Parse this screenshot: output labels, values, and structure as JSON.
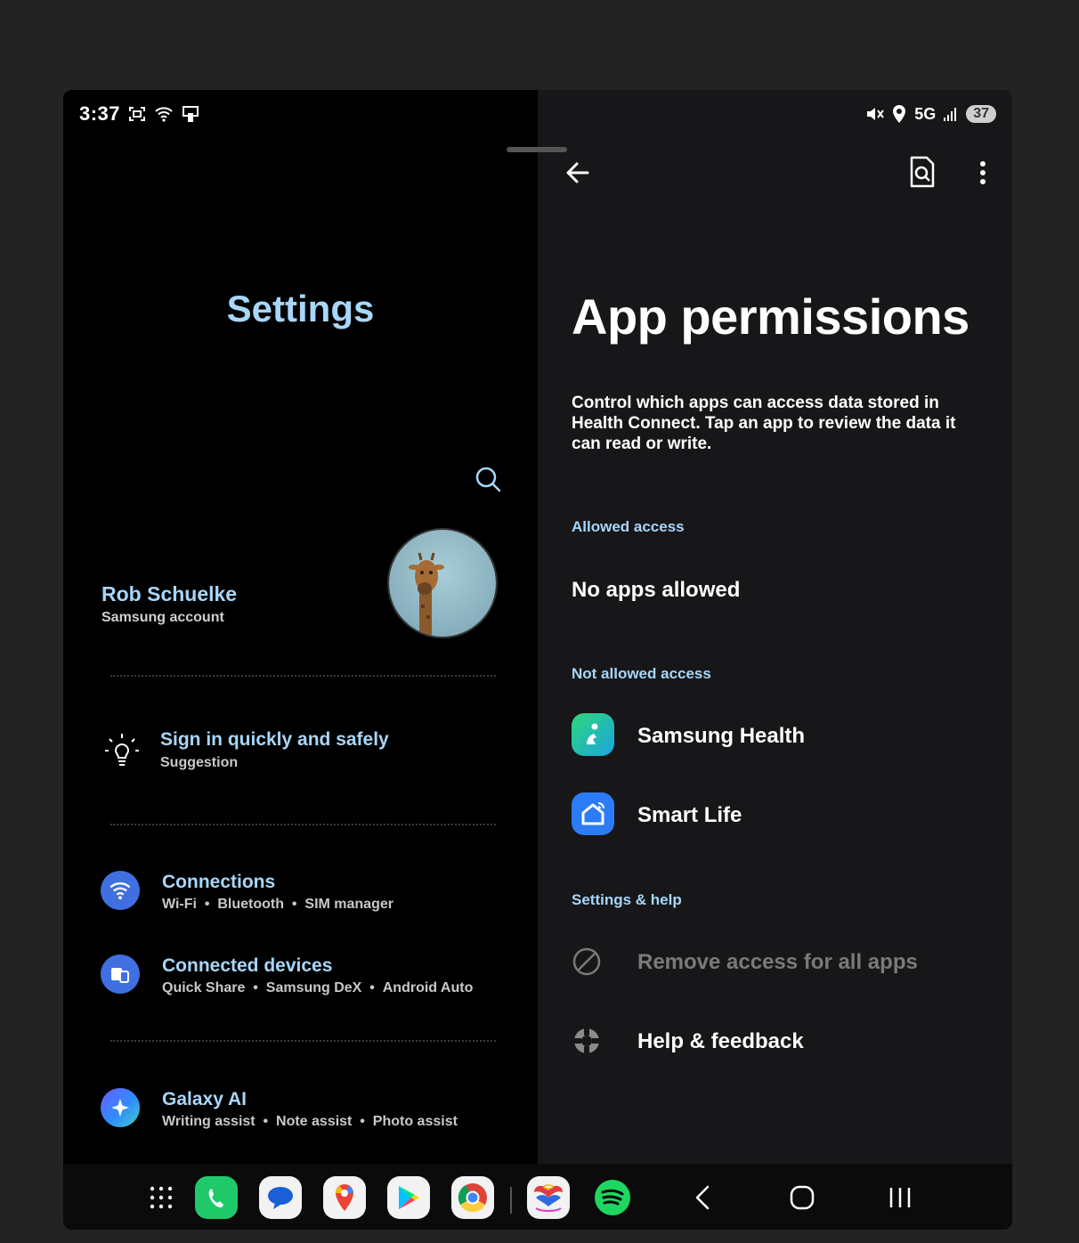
{
  "status_bar": {
    "time": "3:37",
    "network": "5G",
    "battery": "37",
    "left_icons": [
      "screenshot-icon",
      "wifi-icon",
      "cast-icon"
    ],
    "right_icons": [
      "mute-icon",
      "location-icon",
      "signal-icon"
    ]
  },
  "left": {
    "title": "Settings",
    "profile": {
      "name": "Rob Schuelke",
      "sub": "Samsung account"
    },
    "suggestion": {
      "title": "Sign in quickly and safely",
      "sub": "Suggestion"
    },
    "items": [
      {
        "title": "Connections",
        "sub": [
          "Wi-Fi",
          "Bluetooth",
          "SIM manager"
        ]
      },
      {
        "title": "Connected devices",
        "sub": [
          "Quick Share",
          "Samsung DeX",
          "Android Auto"
        ]
      },
      {
        "title": "Galaxy AI",
        "sub": [
          "Writing assist",
          "Note assist",
          "Photo assist"
        ]
      }
    ],
    "separator": "•"
  },
  "right": {
    "title": "App permissions",
    "description": "Control which apps can access data stored in Health Connect. Tap an app to review the data it can read or write.",
    "sections": {
      "allowed": {
        "header": "Allowed access",
        "empty": "No apps allowed"
      },
      "not_allowed": {
        "header": "Not allowed access",
        "apps": [
          "Samsung Health",
          "Smart Life"
        ]
      },
      "settings_help": {
        "header": "Settings & help",
        "remove": "Remove access for all apps",
        "help": "Help & feedback"
      }
    }
  },
  "dock": {
    "apps": [
      "apps-grid-icon",
      "phone-icon",
      "messages-icon",
      "maps-icon",
      "play-store-icon",
      "chrome-icon",
      "vital-water-icon",
      "spotify-icon"
    ],
    "nav": [
      "nav-back-icon",
      "nav-home-icon",
      "nav-recents-icon"
    ]
  },
  "colors": {
    "accent": "#a7d6f9",
    "background_left": "#000000",
    "background_right": "#17171a"
  }
}
